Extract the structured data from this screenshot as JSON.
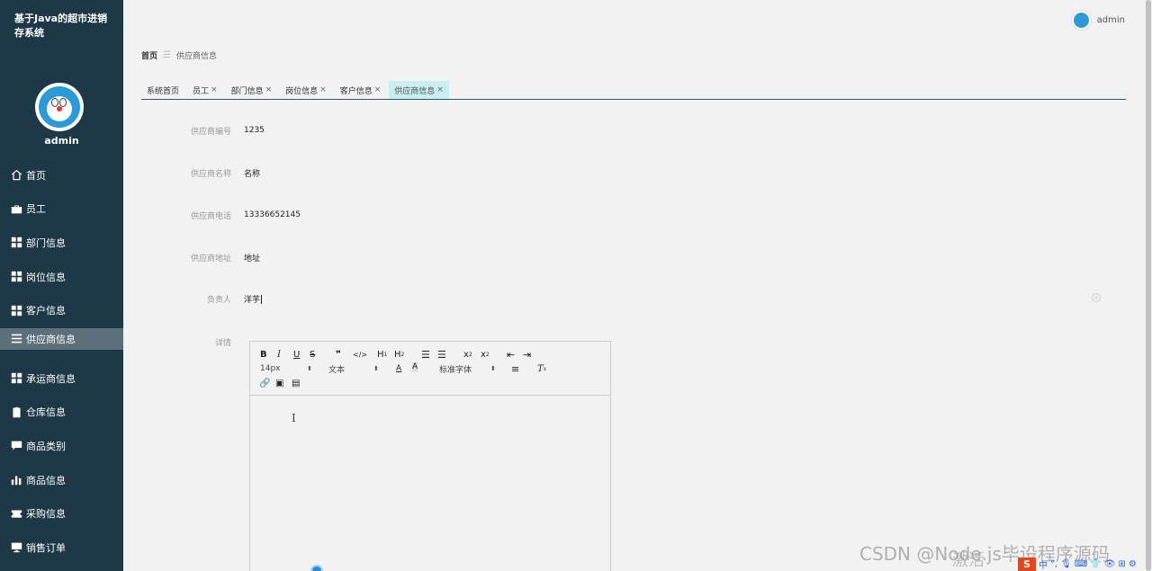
{
  "app": {
    "title": "基于Java的超市进销存系统"
  },
  "sidebar": {
    "username": "admin",
    "items": [
      {
        "label": "首页",
        "icon": "home-icon"
      },
      {
        "label": "员工",
        "icon": "briefcase-icon"
      },
      {
        "label": "部门信息",
        "icon": "grid-icon"
      },
      {
        "label": "岗位信息",
        "icon": "grid-icon"
      },
      {
        "label": "客户信息",
        "icon": "grid-icon"
      },
      {
        "label": "供应商信息",
        "icon": "list-icon"
      },
      {
        "label": "承运商信息",
        "icon": "grid-icon"
      },
      {
        "label": "仓库信息",
        "icon": "clipboard-icon"
      },
      {
        "label": "商品类别",
        "icon": "chat-icon"
      },
      {
        "label": "商品信息",
        "icon": "bar-chart-icon"
      },
      {
        "label": "采购信息",
        "icon": "ticket-icon"
      },
      {
        "label": "销售订单",
        "icon": "monitor-icon"
      }
    ]
  },
  "header": {
    "username": "admin"
  },
  "breadcrumb": {
    "home": "首页",
    "current": "供应商信息"
  },
  "tabs": [
    {
      "label": "系统首页",
      "closable": false
    },
    {
      "label": "员工",
      "closable": true
    },
    {
      "label": "部门信息",
      "closable": true
    },
    {
      "label": "岗位信息",
      "closable": true
    },
    {
      "label": "客户信息",
      "closable": true
    },
    {
      "label": "供应商信息",
      "closable": true,
      "active": true
    }
  ],
  "form": {
    "supplier_no": {
      "label": "供应商编号",
      "value": "1235"
    },
    "supplier_name": {
      "label": "供应商名称",
      "value": "名称"
    },
    "supplier_phone": {
      "label": "供应商电话",
      "value": "13336652145"
    },
    "supplier_address": {
      "label": "供应商地址",
      "value": "地址"
    },
    "manager": {
      "label": "负责人",
      "value": "洋芋"
    },
    "details": {
      "label": "详情"
    }
  },
  "editor": {
    "font_size": "14px",
    "header_select": "文本",
    "font_family": "标准字体"
  },
  "watermark": "CSDN @Node.js毕设程序源码",
  "activate_text": "激活",
  "colors": {
    "sidebar_bg": "#1d3847",
    "active_tab": "#c9eef0",
    "active_menu": "#5c6f7b"
  }
}
